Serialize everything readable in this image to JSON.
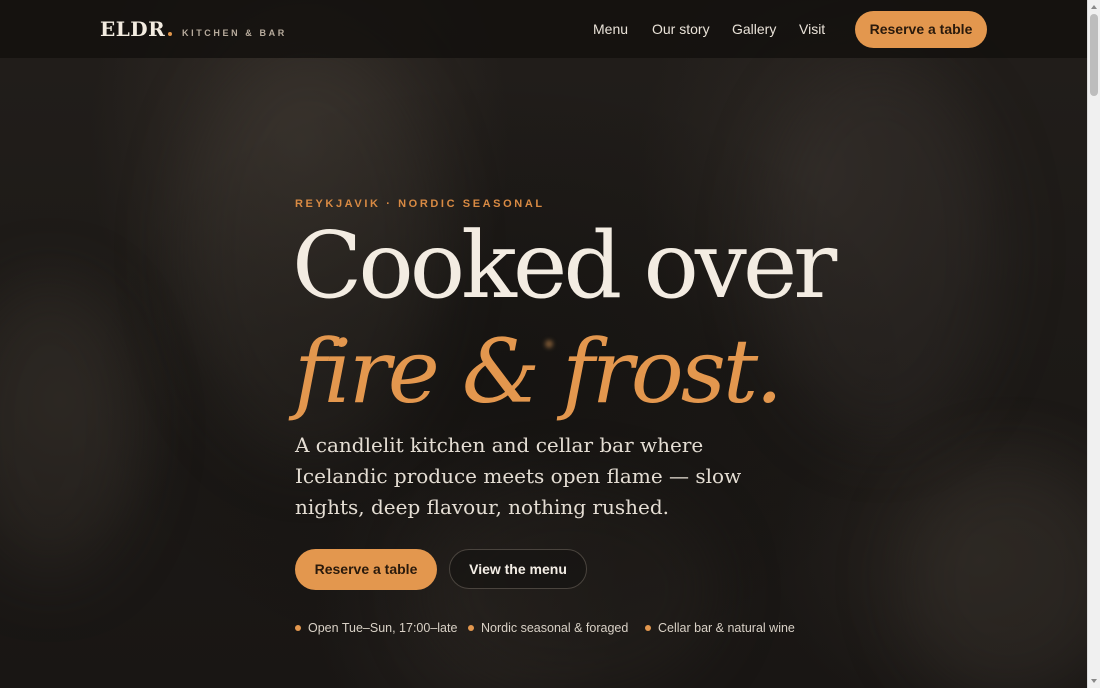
{
  "brand": {
    "name": "ELDR",
    "tagline": "KITCHEN & BAR",
    "accent_color": "#e3974e"
  },
  "nav": {
    "items": [
      {
        "label": "Menu"
      },
      {
        "label": "Our story"
      },
      {
        "label": "Gallery"
      },
      {
        "label": "Visit"
      }
    ],
    "cta_label": "Reserve a table"
  },
  "hero": {
    "eyebrow": "REYKJAVIK · NORDIC SEASONAL",
    "headline_line1": "Cooked over",
    "headline_line2": "fire & frost.",
    "lede": "A candlelit kitchen and cellar bar where Icelandic produce meets open flame — slow nights, deep flavour, nothing rushed.",
    "primary_cta": "Reserve a table",
    "secondary_cta": "View the menu",
    "features": [
      {
        "text": "Open Tue–Sun, 17:00–late"
      },
      {
        "text": "Nordic seasonal & foraged"
      },
      {
        "text": "Cellar bar & natural wine"
      }
    ]
  }
}
